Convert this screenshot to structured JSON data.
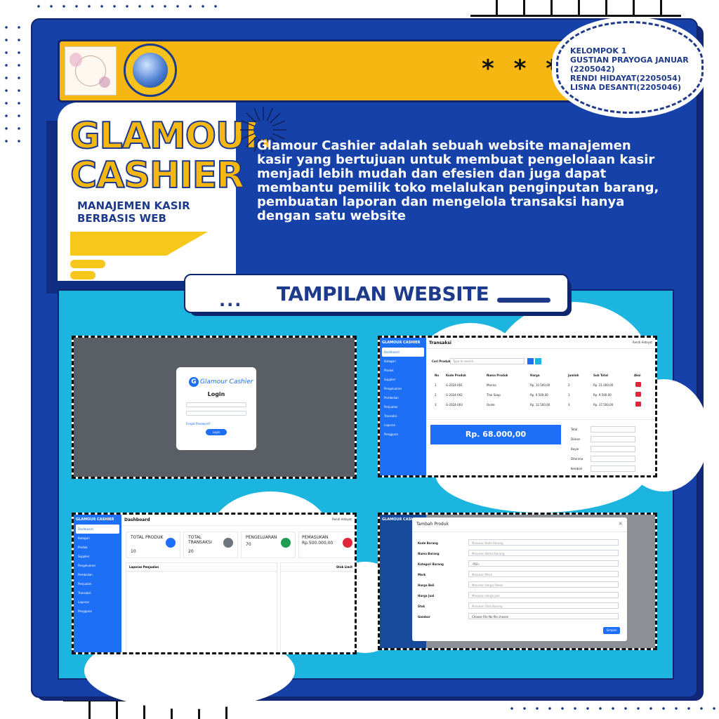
{
  "team": {
    "lines": [
      "KELOMPOK 1",
      "GUSTIAN PRAYOGA JANUAR",
      "(2205042)",
      "RENDI HIDAYAT(2205054)",
      "LISNA DESANTI(2205046)"
    ]
  },
  "title": {
    "line1": "GLAMOUR",
    "line2": "CASHIER",
    "sub1": "MANAJEMEN KASIR",
    "sub2": "BERBASIS WEB"
  },
  "stars": "* * *",
  "description": "Glamour Cashier adalah sebuah website manajemen kasir yang bertujuan untuk membuat pengelolaan kasir menjadi lebih mudah dan efesien dan juga dapat membantu pemilik toko melalukan penginputan barang, pembuatan laporan dan mengelola transaksi hanya dengan satu website",
  "section": {
    "dots": "...",
    "title": "TAMPILAN WEBSITE"
  },
  "login": {
    "brand": "Glamour Cashier",
    "title": "Login",
    "forgot": "Forgot Password?",
    "button": "Login"
  },
  "app": {
    "brand": "GLAMOUR CASHIER",
    "user": "Rendi Hidayat",
    "menu": [
      "Dashboard",
      "Kategori",
      "Produk",
      "Supplier",
      "Pengeluaran",
      "Pembelian",
      "Penjualan",
      "Transaksi",
      "Laporan",
      "Pengguna"
    ]
  },
  "transaksi": {
    "title": "Transaksi",
    "search_label": "Cari Produk",
    "search_placeholder": "Type to search...",
    "headers": [
      "No",
      "Kode Produk",
      "Nama Produk",
      "Harga",
      "Jumlah",
      "Sub Total",
      "Aksi"
    ],
    "rows": [
      [
        "1",
        "G-2024-001",
        "Marina",
        "Rp. 10.500,00",
        "2",
        "Rp. 21.000,00"
      ],
      [
        "2",
        "G-2024-002",
        "Thai Soap",
        "Rp. 9.500,00",
        "1",
        "Rp. 9.500,00"
      ],
      [
        "3",
        "G-2024-003",
        "Ovale",
        "Rp. 12.500,00",
        "3",
        "Rp. 37.500,00"
      ]
    ],
    "total_display": "Rp. 68.000,00",
    "summary_labels": [
      "Total",
      "Diskon",
      "Bayar",
      "Diterima",
      "Kembali"
    ]
  },
  "dashboard": {
    "title": "Dashboard",
    "cards": [
      {
        "label": "TOTAL PRODUK",
        "value": "10",
        "color": "#1d6ff5"
      },
      {
        "label": "TOTAL TRANSAKSI",
        "value": "20",
        "color": "#6c757d"
      },
      {
        "label": "PENGELUARAN",
        "value": "70",
        "color": "#1f9d55"
      },
      {
        "label": "PEMASUKAN",
        "value": "Rp.500.000,00",
        "color": "#e0263a"
      }
    ],
    "panel_left": "Laporan Penjualan",
    "panel_right": "Stok Limit"
  },
  "tambah": {
    "title": "Tambah Produk",
    "fields": [
      {
        "label": "Kode Barang",
        "placeholder": "Masukan Kode Barang"
      },
      {
        "label": "Nama Barang",
        "placeholder": "Masukan Nama Barang"
      },
      {
        "label": "Kategori Barang",
        "placeholder": "-Pilih-"
      },
      {
        "label": "Merk",
        "placeholder": "Masukan Merk"
      },
      {
        "label": "Harga Beli",
        "placeholder": "Masukan Harga Pokok"
      },
      {
        "label": "Harga Jual",
        "placeholder": "Masukan Harga Jual"
      },
      {
        "label": "Stok",
        "placeholder": "Masukan Stok Barang"
      },
      {
        "label": "Gambar",
        "placeholder": "Choose File  No file chosen"
      }
    ],
    "save": "Simpan"
  },
  "colors": {
    "navy": "#1541a8",
    "yellow": "#f6b712",
    "cyan": "#1bb5e0",
    "app_blue": "#1d6ff5"
  }
}
